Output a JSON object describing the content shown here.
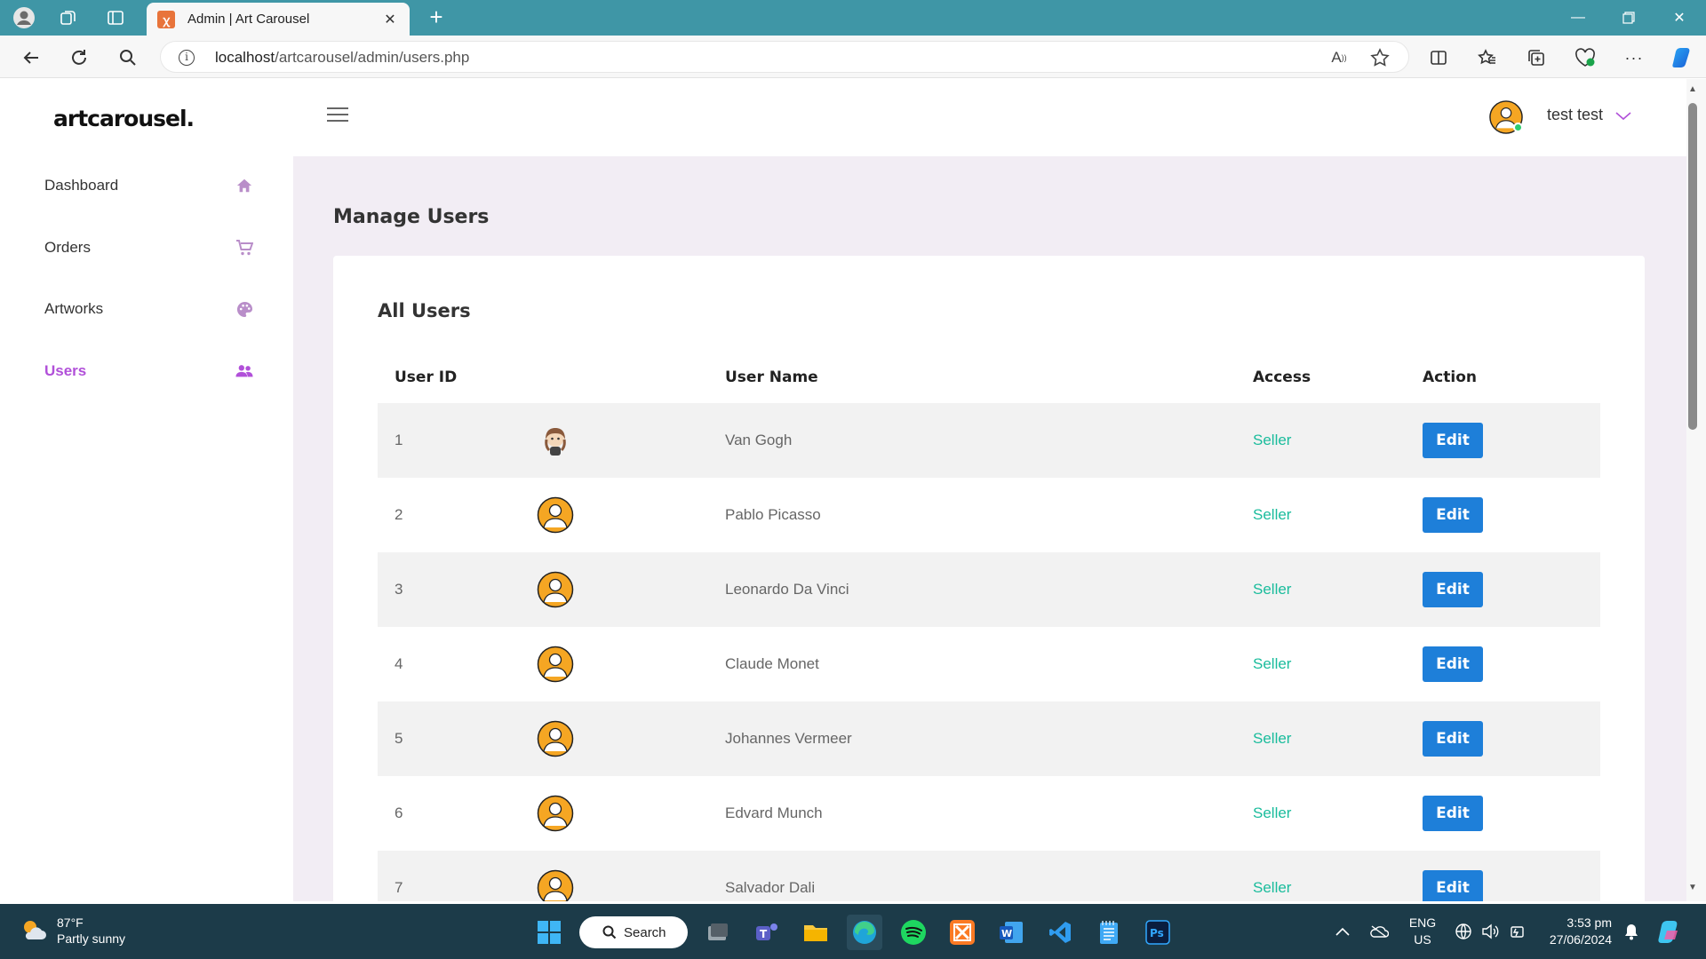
{
  "browser": {
    "tab_title": "Admin | Art Carousel",
    "url_host": "localhost",
    "url_path": "/artcarousel/admin/users.php"
  },
  "app": {
    "logo": "artcarousel.",
    "user_display_name": "test test"
  },
  "sidebar": {
    "items": [
      {
        "label": "Dashboard",
        "icon": "home-icon"
      },
      {
        "label": "Orders",
        "icon": "cart-icon"
      },
      {
        "label": "Artworks",
        "icon": "palette-icon"
      },
      {
        "label": "Users",
        "icon": "users-icon",
        "active": true
      }
    ],
    "active_color": "#b150d9"
  },
  "main": {
    "page_title": "Manage Users",
    "card_title": "All Users",
    "table": {
      "headers": {
        "id": "User ID",
        "name": "User Name",
        "access": "Access",
        "action": "Action"
      },
      "rows": [
        {
          "id": "1",
          "name": "Van Gogh",
          "access": "Seller",
          "action": "Edit",
          "avatar": "custom"
        },
        {
          "id": "2",
          "name": "Pablo Picasso",
          "access": "Seller",
          "action": "Edit",
          "avatar": "default"
        },
        {
          "id": "3",
          "name": "Leonardo Da Vinci",
          "access": "Seller",
          "action": "Edit",
          "avatar": "default"
        },
        {
          "id": "4",
          "name": "Claude Monet",
          "access": "Seller",
          "action": "Edit",
          "avatar": "default"
        },
        {
          "id": "5",
          "name": "Johannes Vermeer",
          "access": "Seller",
          "action": "Edit",
          "avatar": "default"
        },
        {
          "id": "6",
          "name": "Edvard Munch",
          "access": "Seller",
          "action": "Edit",
          "avatar": "default"
        },
        {
          "id": "7",
          "name": "Salvador Dali",
          "access": "Seller",
          "action": "Edit",
          "avatar": "default"
        }
      ]
    },
    "colors": {
      "access": "#1abc9c",
      "edit_button": "#1e7fd9",
      "content_bg": "#f2edf4"
    }
  },
  "taskbar": {
    "weather_temp": "87°F",
    "weather_desc": "Partly sunny",
    "search_label": "Search",
    "lang_line1": "ENG",
    "lang_line2": "US",
    "time": "3:53 pm",
    "date": "27/06/2024"
  }
}
